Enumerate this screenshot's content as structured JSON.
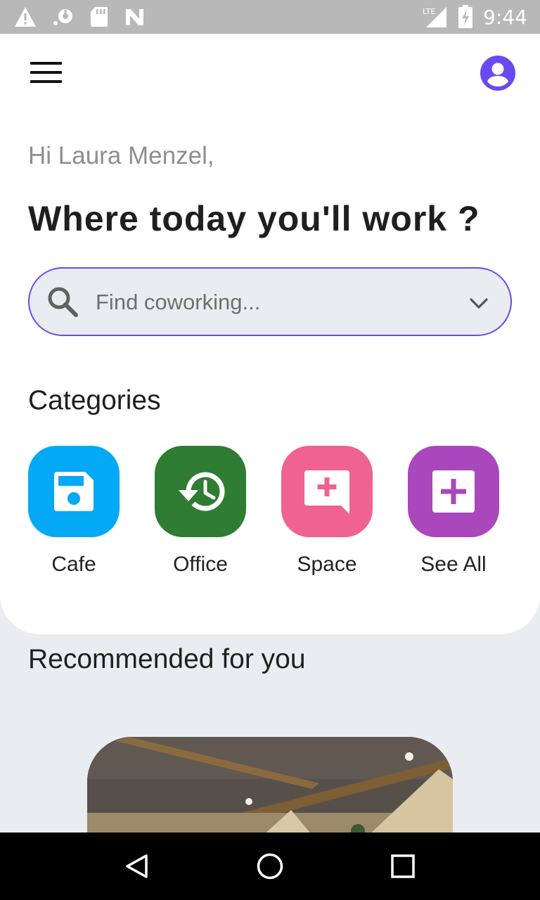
{
  "status_bar": {
    "time": "9:44",
    "network_label": "LTE",
    "icons": [
      "warning-icon",
      "sync-icon",
      "sd-card-icon",
      "n-icon",
      "lte-signal-icon",
      "battery-charging-icon"
    ]
  },
  "header": {
    "menu_icon": "hamburger-icon",
    "profile_icon": "account-circle-icon"
  },
  "greeting": "Hi Laura Menzel,",
  "headline": "Where today you'll work ?",
  "search": {
    "placeholder": "Find coworking...",
    "value": ""
  },
  "categories": {
    "title": "Categories",
    "items": [
      {
        "label": "Cafe",
        "icon": "save-icon",
        "color": "#03a9f4"
      },
      {
        "label": "Office",
        "icon": "history-icon",
        "color": "#2e7d32"
      },
      {
        "label": "Space",
        "icon": "add-comment-icon",
        "color": "#f06292"
      },
      {
        "label": "See All",
        "icon": "add-box-icon",
        "color": "#ab47bc"
      }
    ]
  },
  "recommended": {
    "title": "Recommended for you"
  },
  "colors": {
    "accent": "#6a4af0",
    "background": "#e9ecf0",
    "card": "#ffffff"
  },
  "nav": {
    "back_icon": "back-triangle-icon",
    "home_icon": "home-circle-icon",
    "recents_icon": "recents-square-icon"
  }
}
